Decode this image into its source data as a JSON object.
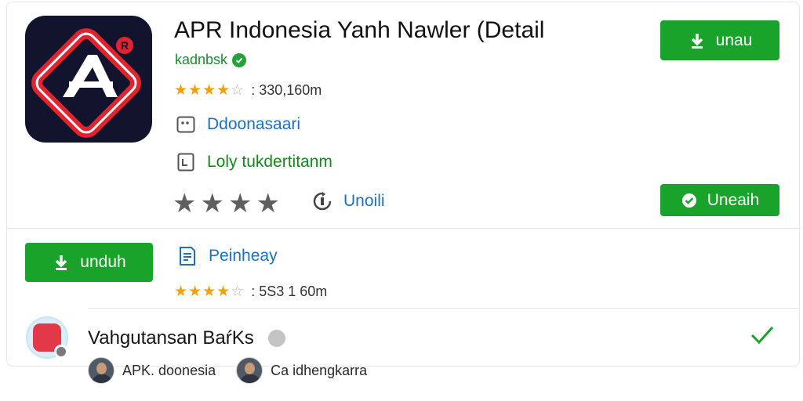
{
  "app": {
    "title": "APR Indonesia Yanh Nawler (Detail",
    "developer": "kadnbsk",
    "rating_count": ": 330,160m"
  },
  "meta": {
    "category": "Ddoonasaari",
    "license": "Loly tukdertitanm",
    "update_label": "Unoili"
  },
  "buttons": {
    "download_top": "unau",
    "update": "Uneaih",
    "download_secondary": "unduh"
  },
  "secondary": {
    "label": "Peinheay",
    "rating_count": ": 5S3 1 60m"
  },
  "developer_section": {
    "name": "Vahgutansan BaŕKs",
    "people": [
      {
        "name": "APK. doonesia"
      },
      {
        "name": "Ca idhengkarra"
      }
    ]
  },
  "colors": {
    "primary_green": "#1aa32a",
    "star_gold": "#f2a100",
    "link_blue": "#1f6fc0",
    "icon_background": "#12142e",
    "icon_red": "#e2232e"
  },
  "icons": {
    "verified": "verified-check-icon",
    "category": "category-icon",
    "license": "license-icon",
    "update": "update-icon",
    "download": "download-icon",
    "check": "checkmark-icon"
  }
}
